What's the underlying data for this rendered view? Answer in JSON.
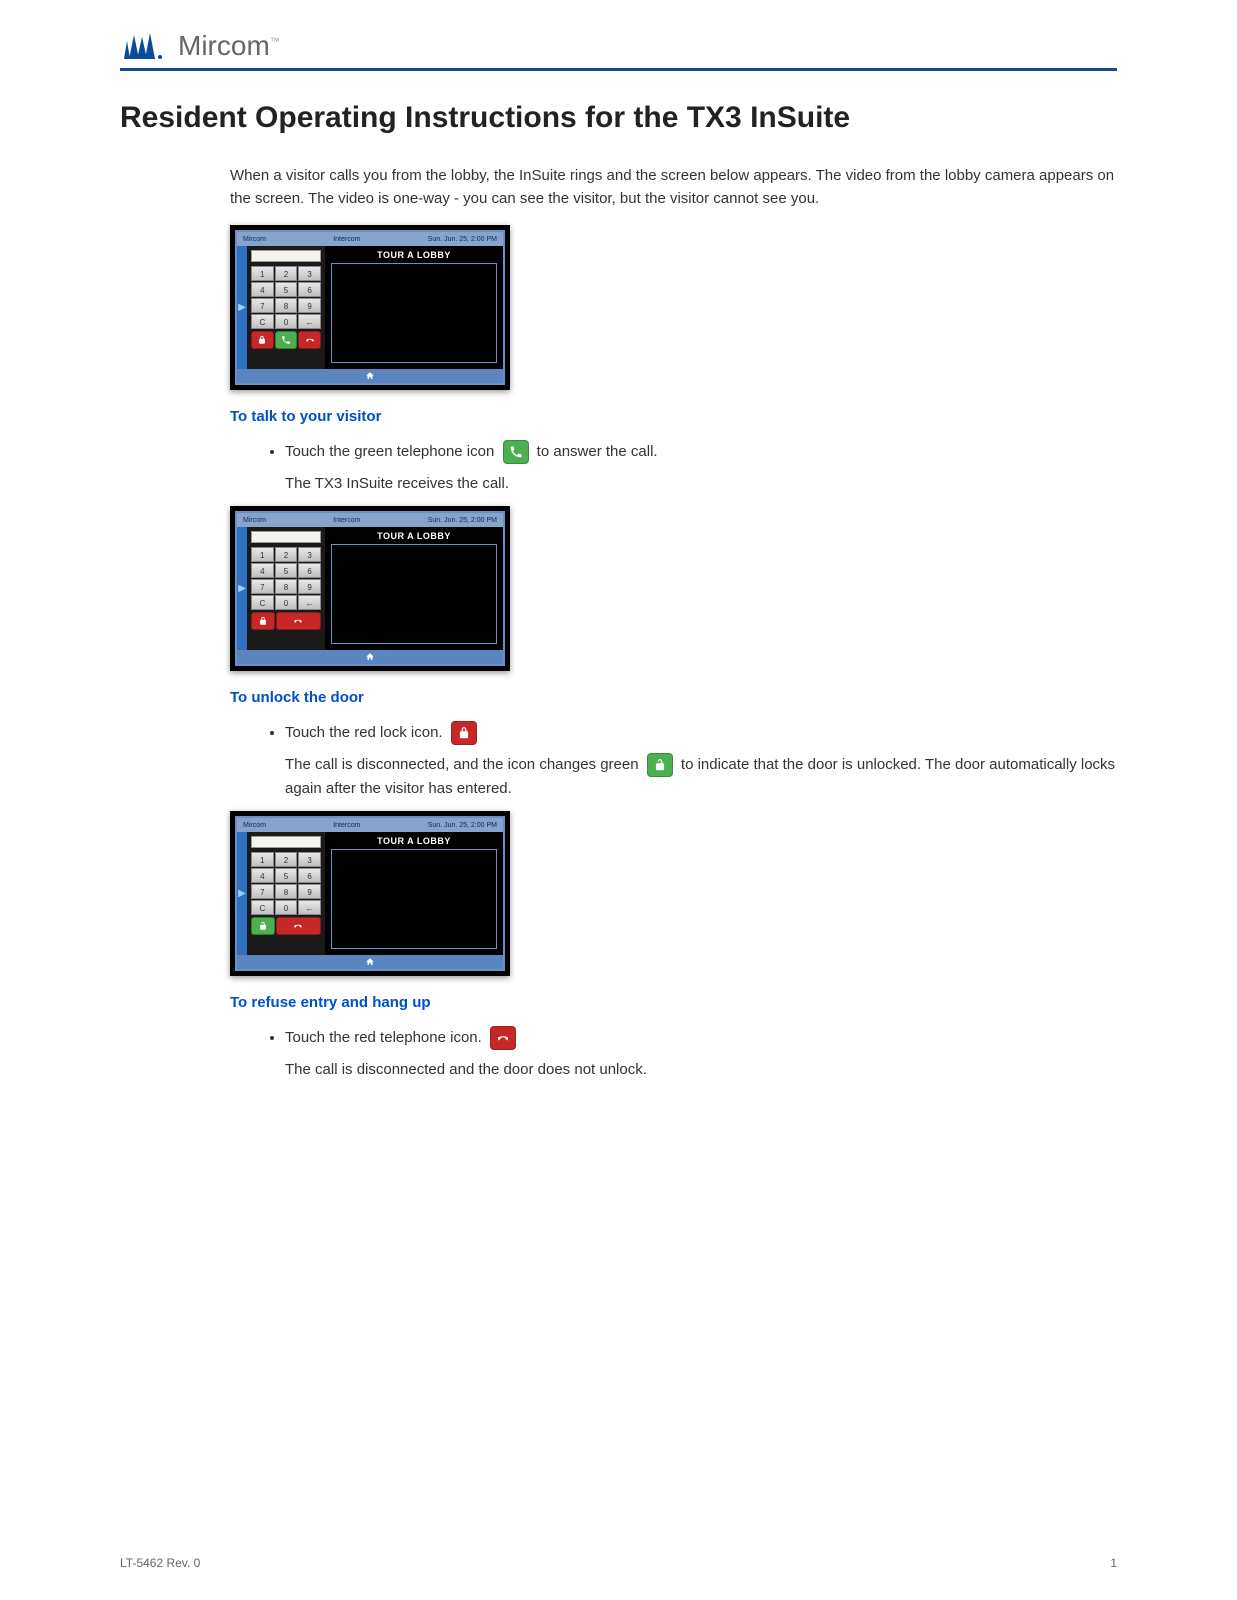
{
  "brand": {
    "name": "Mircom",
    "tm": "™"
  },
  "title": "Resident Operating Instructions for the TX3 InSuite",
  "intro": "When a visitor calls you from the lobby, the InSuite rings and the screen below appears. The video from the lobby camera appears on the screen. The video is one-way - you can see the visitor, but the visitor cannot see you.",
  "device": {
    "header_left": "Mircom",
    "header_center": "Intercom",
    "header_right": "Sun. Jun. 25, 2:00 PM",
    "video_title": "TOUR A LOBBY",
    "keypad": [
      "1",
      "2",
      "3",
      "4",
      "5",
      "6",
      "7",
      "8",
      "9",
      "C",
      "0",
      "←"
    ]
  },
  "sections": {
    "talk": {
      "title": "To talk to your visitor",
      "bullet_pre": "Touch the green telephone icon",
      "bullet_post": "to answer the call.",
      "sub": "The TX3 InSuite receives the call."
    },
    "unlock": {
      "title": "To unlock the door",
      "bullet": "Touch the red lock icon.",
      "sub_pre": "The call is disconnected, and the icon changes green",
      "sub_post": "to indicate that the door is unlocked. The door automatically locks again after the visitor has entered."
    },
    "refuse": {
      "title": "To refuse entry and hang up",
      "bullet": "Touch the red telephone icon.",
      "sub": "The call is disconnected and the door does not unlock."
    }
  },
  "footer": {
    "doc": "LT-5462 Rev. 0",
    "page": "1"
  }
}
